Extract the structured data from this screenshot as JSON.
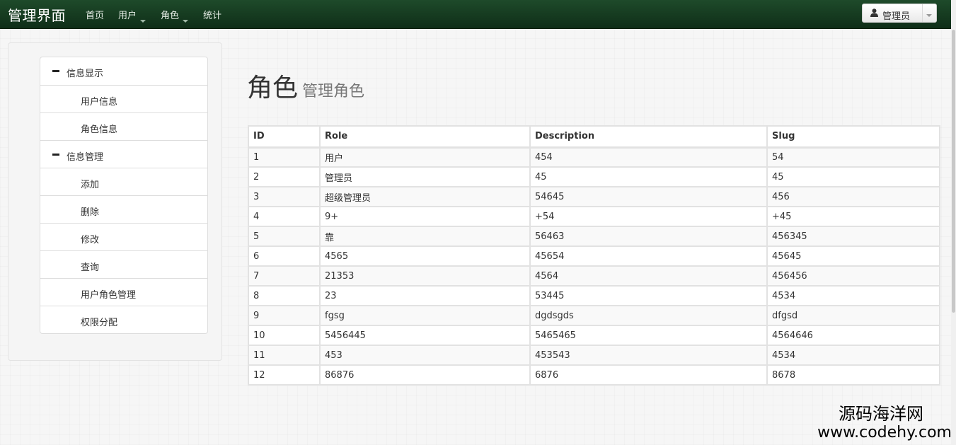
{
  "navbar": {
    "brand": "管理界面",
    "items": [
      {
        "label": "首页",
        "dropdown": false
      },
      {
        "label": "用户",
        "dropdown": true
      },
      {
        "label": "角色",
        "dropdown": true
      },
      {
        "label": "统计",
        "dropdown": false
      }
    ],
    "user_button": {
      "label": "管理员",
      "icon": "user-icon"
    }
  },
  "sidebar": {
    "groups": [
      {
        "label": "信息显示",
        "icon": "minus-icon",
        "items": [
          "用户信息",
          "角色信息"
        ]
      },
      {
        "label": "信息管理",
        "icon": "minus-icon",
        "items": [
          "添加",
          "删除",
          "修改",
          "查询",
          "用户角色管理",
          "权限分配"
        ]
      }
    ]
  },
  "page": {
    "title": "角色",
    "subtitle": "管理角色"
  },
  "table": {
    "headers": [
      "ID",
      "Role",
      "Description",
      "Slug"
    ],
    "rows": [
      [
        "1",
        "用户",
        "454",
        "54"
      ],
      [
        "2",
        "管理员",
        "45",
        "45"
      ],
      [
        "3",
        "超级管理员",
        "54645",
        "456"
      ],
      [
        "4",
        "9+",
        "+54",
        "+45"
      ],
      [
        "5",
        "靠",
        "56463",
        "456345"
      ],
      [
        "6",
        "4565",
        "45654",
        "45645"
      ],
      [
        "7",
        "21353",
        "4564",
        "456456"
      ],
      [
        "8",
        "23",
        "53445",
        "4534"
      ],
      [
        "9",
        "fgsg",
        "dgdsgds",
        "dfgsd"
      ],
      [
        "10",
        "5456445",
        "5465465",
        "4564646"
      ],
      [
        "11",
        "453",
        "453543",
        "4534"
      ],
      [
        "12",
        "86876",
        "6876",
        "8678"
      ]
    ]
  },
  "watermark": {
    "line1": "源码海洋网",
    "line2": "www.codehy.com"
  }
}
